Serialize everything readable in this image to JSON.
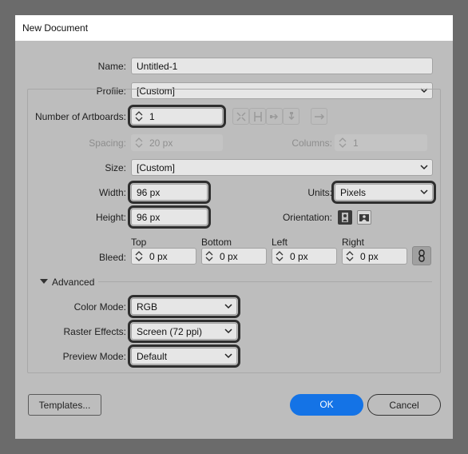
{
  "window": {
    "title": "New Document"
  },
  "name": {
    "label": "Name:",
    "value": "Untitled-1"
  },
  "profile": {
    "label": "Profile:",
    "value": "[Custom]"
  },
  "artboards": {
    "label": "Number of Artboards:",
    "value": "1"
  },
  "spacing": {
    "label": "Spacing:",
    "value": "20 px"
  },
  "columns": {
    "label": "Columns:",
    "value": "1"
  },
  "size": {
    "label": "Size:",
    "value": "[Custom]"
  },
  "width": {
    "label": "Width:",
    "value": "96 px"
  },
  "units": {
    "label": "Units:",
    "value": "Pixels"
  },
  "height": {
    "label": "Height:",
    "value": "96 px"
  },
  "orientation": {
    "label": "Orientation:"
  },
  "bleed": {
    "label": "Bleed:",
    "top_label": "Top",
    "top_value": "0 px",
    "bottom_label": "Bottom",
    "bottom_value": "0 px",
    "left_label": "Left",
    "left_value": "0 px",
    "right_label": "Right",
    "right_value": "0 px"
  },
  "advanced": {
    "label": "Advanced",
    "color_mode_label": "Color Mode:",
    "color_mode": "RGB",
    "raster_label": "Raster Effects:",
    "raster": "Screen (72 ppi)",
    "preview_label": "Preview Mode:",
    "preview": "Default"
  },
  "buttons": {
    "templates": "Templates...",
    "ok": "OK",
    "cancel": "Cancel"
  },
  "colors": {
    "accent": "#1473e6",
    "dialog_bg": "#bdbdbd",
    "highlight": "#2f2f2f"
  }
}
